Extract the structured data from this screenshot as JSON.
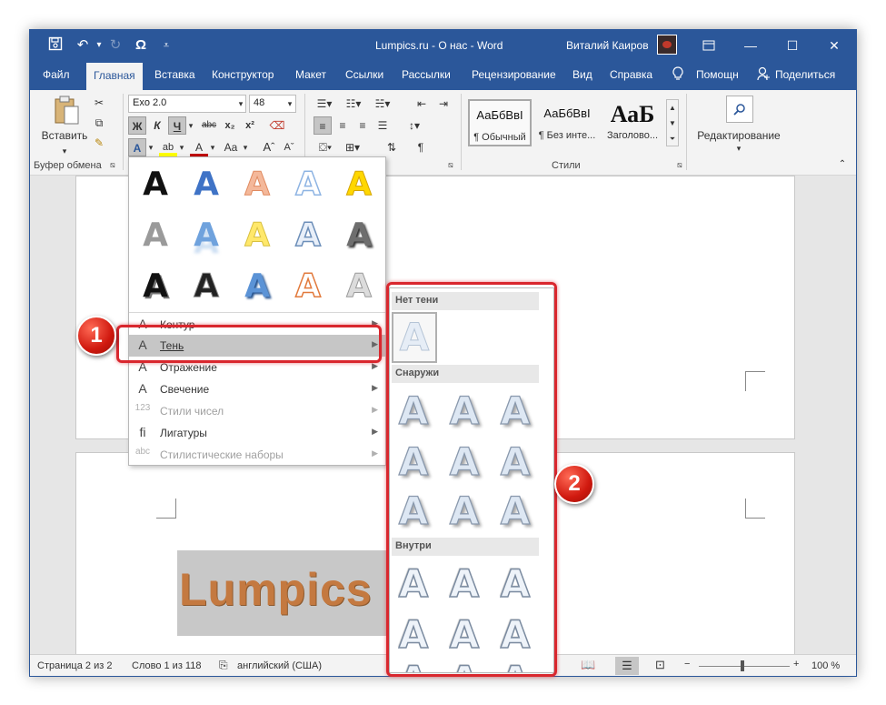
{
  "titlebar": {
    "title": "Lumpics.ru - О нас  -  Word",
    "user": "Виталий Каиров",
    "icons": [
      "save-icon",
      "undo-icon",
      "redo-icon",
      "omega-icon",
      "customize-icon"
    ],
    "window_buttons": [
      "ribbon-display-icon",
      "minimize-icon",
      "maximize-icon",
      "close-icon"
    ]
  },
  "menubar": {
    "tabs": [
      "Файл",
      "Главная",
      "Вставка",
      "Конструктор",
      "Макет",
      "Ссылки",
      "Рассылки",
      "Рецензирование",
      "Вид",
      "Справка",
      "Помощн",
      "Поделиться"
    ],
    "active": "Главная"
  },
  "ribbon": {
    "clipboard": {
      "paste": "Вставить",
      "label": "Буфер обмена"
    },
    "font": {
      "name": "Exo 2.0",
      "size": "48",
      "bold": "Ж",
      "italic": "К",
      "underline": "Ч",
      "strike": "abc",
      "sub": "x₂",
      "sup": "x²",
      "case": "Aa"
    },
    "styles": {
      "label": "Стили",
      "items": [
        {
          "sample": "АаБбВвI",
          "name": "¶ Обычный"
        },
        {
          "sample": "АаБбВвI",
          "name": "¶ Без инте..."
        },
        {
          "sample": "АаБ",
          "name": "Заголово..."
        }
      ]
    },
    "editing": {
      "label": "Редактирование"
    }
  },
  "effects_menu": {
    "items": [
      {
        "label": "Контур",
        "icon": "outline-icon",
        "enabled": true,
        "highlighted": false
      },
      {
        "label": "Тень",
        "icon": "shadow-icon",
        "enabled": true,
        "highlighted": true
      },
      {
        "label": "Отражение",
        "icon": "reflection-icon",
        "enabled": true,
        "highlighted": false
      },
      {
        "label": "Свечение",
        "icon": "glow-icon",
        "enabled": true,
        "highlighted": false
      },
      {
        "label": "Стили чисел",
        "icon": "number-styles-icon",
        "enabled": false,
        "highlighted": false
      },
      {
        "label": "Лигатуры",
        "icon": "ligature-icon",
        "enabled": true,
        "highlighted": false
      },
      {
        "label": "Стилистические наборы",
        "icon": "stylistic-sets-icon",
        "enabled": false,
        "highlighted": false
      }
    ],
    "gallery_glyph": "A"
  },
  "shadow_panel": {
    "sections": [
      "Нет тени",
      "Снаружи",
      "Внутри"
    ],
    "glyph": "A"
  },
  "document": {
    "text": "Lumpics"
  },
  "statusbar": {
    "page": "Страница 2 из 2",
    "words": "Слово 1 из 118",
    "language": "английский (США)",
    "zoom": "100 %"
  },
  "annotations": {
    "badge1": "1",
    "badge2": "2"
  },
  "colors": {
    "accent": "#2b579a",
    "highlight_red": "#d9272e"
  }
}
